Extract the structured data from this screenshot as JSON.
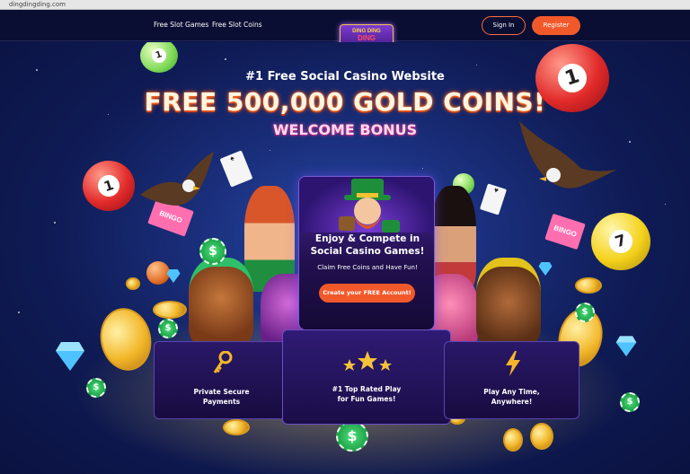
{
  "browser": {
    "url": "dingdingding.com"
  },
  "nav": {
    "links": [
      "Free Slot Games",
      "Free Slot Coins"
    ],
    "logo_text": {
      "top": "DING DING",
      "bottom": "DING"
    },
    "sign_in": "Sign In",
    "register": "Register"
  },
  "hero": {
    "tagline": "#1 Free Social Casino Website",
    "headline": "FREE 500,000 GOLD COINS!",
    "subhead": "WELCOME BONUS"
  },
  "promo": {
    "title_line1": "Enjoy & Compete in",
    "title_line2": "Social Casino Games!",
    "subtitle": "Claim Free Coins and Have Fun!",
    "cta": "Create your FREE Account!"
  },
  "features": [
    {
      "line1": "Private Secure",
      "line2": "Payments",
      "icon": "key-icon"
    },
    {
      "line1": "#1 Top Rated Play",
      "line2": "for Fun Games!",
      "icon": "three-stars-icon"
    },
    {
      "line1": "Play Any Time,",
      "line2": "Anywhere!",
      "icon": "lightning-icon"
    }
  ],
  "decor": {
    "ball_numbers": [
      "1",
      "1",
      "1",
      "7"
    ],
    "chip_symbol": "$",
    "bingo_text": "BINGO",
    "colors": {
      "accent": "#f2592a",
      "headline_glow": "#ff5a1a",
      "subhead_glow": "#ff3fa0",
      "panel": "#22104f"
    }
  }
}
